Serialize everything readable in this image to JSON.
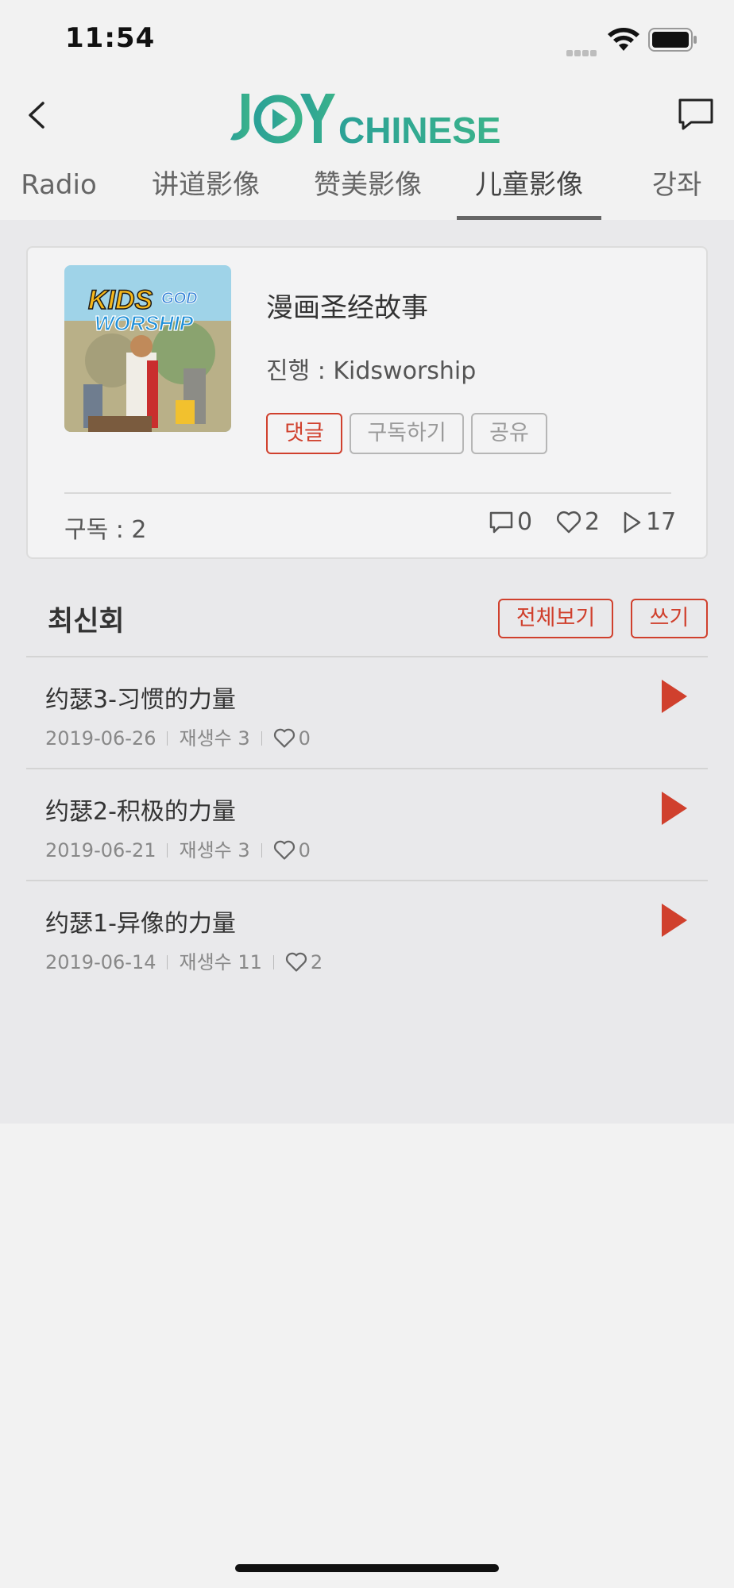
{
  "status_bar": {
    "time": "11:54"
  },
  "header": {
    "logo_text_joy": "JOY",
    "logo_text_chinese": "CHINESE"
  },
  "tabs": [
    {
      "label": "Radio",
      "active": false
    },
    {
      "label": "讲道影像",
      "active": false
    },
    {
      "label": "赞美影像",
      "active": false
    },
    {
      "label": "儿童影像",
      "active": true
    },
    {
      "label": "강좌",
      "active": false
    }
  ],
  "series": {
    "thumbnail_text_1": "KIDS",
    "thumbnail_text_2": "GOD",
    "thumbnail_text_3": "WORSHIP",
    "title": "漫画圣经故事",
    "host": "진행 : Kidsworship",
    "buttons": {
      "comment": "댓글",
      "subscribe": "구독하기",
      "share": "공유"
    },
    "subscribe_count": "구독 : 2",
    "comments": "0",
    "likes": "2",
    "plays": "17"
  },
  "latest": {
    "title": "최신회",
    "view_all": "전체보기",
    "write": "쓰기",
    "episodes": [
      {
        "title": "约瑟3-习惯的力量",
        "date": "2019-06-26",
        "plays": "재생수 3",
        "likes": "0"
      },
      {
        "title": "约瑟2-积极的力量",
        "date": "2019-06-21",
        "plays": "재생수 3",
        "likes": "0"
      },
      {
        "title": "约瑟1-异像的力量",
        "date": "2019-06-14",
        "plays": "재생수 11",
        "likes": "2"
      }
    ]
  },
  "colors": {
    "accent_red": "#d0402d",
    "logo_teal": "#2ba197",
    "logo_green": "#3bb38a"
  }
}
